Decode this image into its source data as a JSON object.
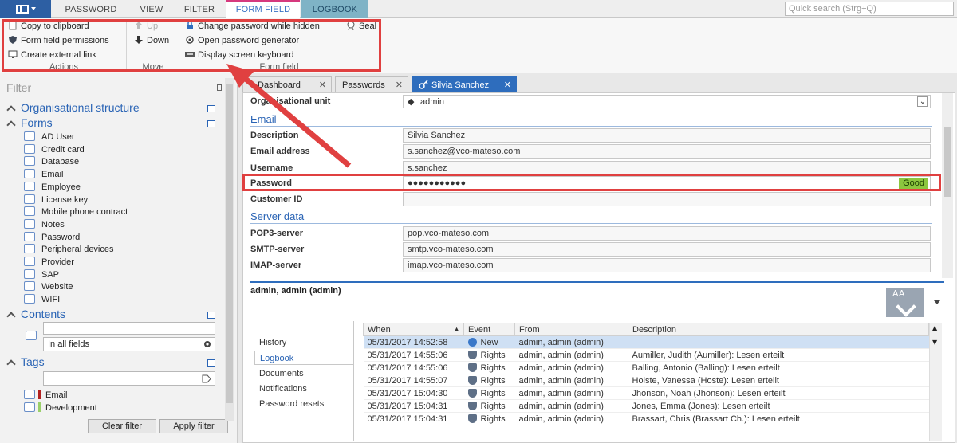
{
  "ribbon_tabs": [
    "PASSWORD",
    "VIEW",
    "FILTER",
    "FORM FIELD",
    "LOGBOOK"
  ],
  "quick_search": {
    "placeholder": "Quick search (Strg+Q)"
  },
  "ribbon": {
    "actions": {
      "label": "Actions",
      "items": [
        "Copy to clipboard",
        "Form field permissions",
        "Create external link"
      ]
    },
    "move": {
      "label": "Move",
      "items": [
        "Up",
        "Down"
      ]
    },
    "form_field": {
      "label": "Form field",
      "items": [
        "Change password while hidden",
        "Open password generator",
        "Display screen keyboard"
      ],
      "seal": "Seal"
    }
  },
  "left_panel": {
    "filter_title": "Filter",
    "org_structure": "Organisational structure",
    "forms_title": "Forms",
    "forms": [
      "AD User",
      "Credit card",
      "Database",
      "Email",
      "Employee",
      "License key",
      "Mobile phone contract",
      "Notes",
      "Password",
      "Peripheral devices",
      "Provider",
      "SAP",
      "Website",
      "WIFI"
    ],
    "contents_title": "Contents",
    "contents_scope": "In all fields",
    "tags_title": "Tags",
    "tags": [
      {
        "label": "Email",
        "color": "#b22222"
      },
      {
        "label": "Development",
        "color": "#9ad06a"
      }
    ],
    "clear_filter": "Clear filter",
    "apply_filter": "Apply filter"
  },
  "doc_tabs": [
    {
      "label": "Dashboard"
    },
    {
      "label": "Passwords"
    },
    {
      "label": "Silvia Sanchez"
    }
  ],
  "form": {
    "org_unit_label": "Organisational unit",
    "org_unit_value": "admin",
    "email_section": "Email",
    "fields": [
      {
        "label": "Description",
        "value": "Silvia Sanchez"
      },
      {
        "label": "Email address",
        "value": "s.sanchez@vco-mateso.com"
      },
      {
        "label": "Username",
        "value": "s.sanchez"
      },
      {
        "label": "Password",
        "value": "●●●●●●●●●●●"
      },
      {
        "label": "Customer ID",
        "value": ""
      }
    ],
    "password_strength": "Good",
    "server_section": "Server data",
    "server_fields": [
      {
        "label": "POP3-server",
        "value": "pop.vco-mateso.com"
      },
      {
        "label": "SMTP-server",
        "value": "smtp.vco-mateso.com"
      },
      {
        "label": "IMAP-server",
        "value": "imap.vco-mateso.com"
      }
    ]
  },
  "details": {
    "owner": "admin, admin (admin)",
    "font_icon_text": "AA",
    "side_tabs": [
      "History",
      "Logbook",
      "Documents",
      "Notifications",
      "Password resets"
    ],
    "active_side_tab": "Logbook",
    "log_columns": [
      "When",
      "Event",
      "From",
      "Description"
    ],
    "log_rows": [
      {
        "when": "05/31/2017 14:52:58",
        "event": "New",
        "from": "admin, admin (admin)",
        "description": ""
      },
      {
        "when": "05/31/2017 14:55:06",
        "event": "Rights",
        "from": "admin, admin (admin)",
        "description": "Aumiller, Judith (Aumiller): Lesen erteilt"
      },
      {
        "when": "05/31/2017 14:55:06",
        "event": "Rights",
        "from": "admin, admin (admin)",
        "description": "Balling, Antonio (Balling): Lesen erteilt"
      },
      {
        "when": "05/31/2017 14:55:07",
        "event": "Rights",
        "from": "admin, admin (admin)",
        "description": "Holste, Vanessa (Hoste): Lesen erteilt"
      },
      {
        "when": "05/31/2017 15:04:30",
        "event": "Rights",
        "from": "admin, admin (admin)",
        "description": "Jhonson, Noah (Jhonson): Lesen erteilt"
      },
      {
        "when": "05/31/2017 15:04:31",
        "event": "Rights",
        "from": "admin, admin (admin)",
        "description": "Jones, Emma (Jones): Lesen erteilt"
      },
      {
        "when": "05/31/2017 15:04:31",
        "event": "Rights",
        "from": "admin, admin (admin)",
        "description": "Brassart, Chris (Brassart Ch.): Lesen erteilt"
      }
    ]
  }
}
